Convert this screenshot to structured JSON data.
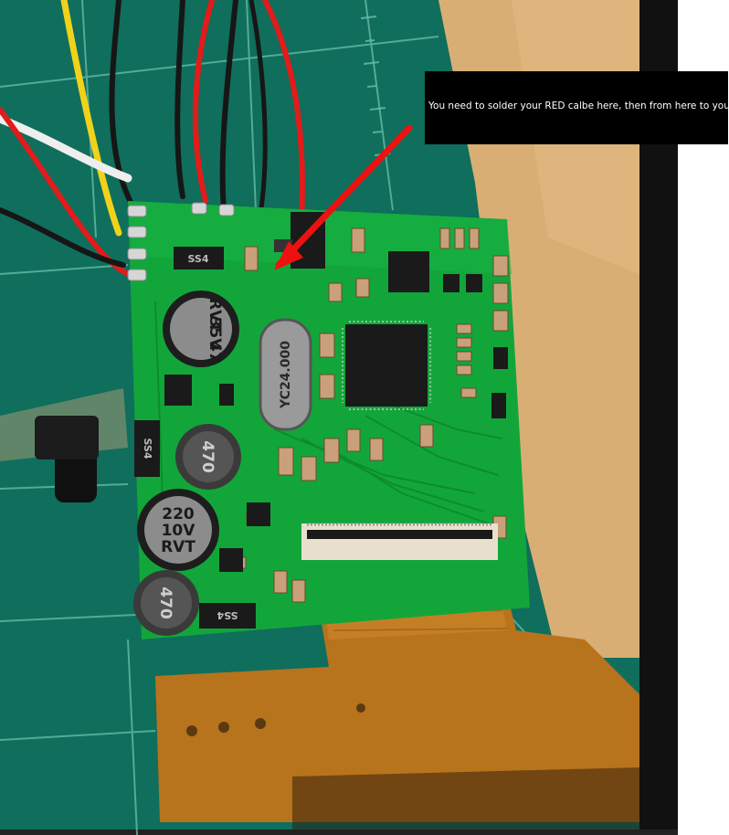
{
  "annotation": {
    "text": "You need to solder your RED calbe here, then from here to your PI",
    "arrow_color": "#ee1111",
    "box_color": "#000000",
    "text_color": "#ffffff"
  },
  "photo": {
    "subject": "green PCB display driver board with attached ribbon cable",
    "colors": {
      "mat": "#0f6e5c",
      "mat_grid": "#6cc0a8",
      "wood": "#d9ae74",
      "pcb": "#12a63a",
      "ribbon": "#b8731d",
      "frame": "#111111"
    }
  },
  "components": {
    "cap_top_left": [
      "47",
      "35V",
      "RVT"
    ],
    "cap_bottom_left": [
      "220",
      "10V",
      "RVT"
    ],
    "crystal": "YC24.000",
    "inductor_mid": "470",
    "inductor_bottom": "470",
    "diode_top": "SS4",
    "diode_bottom": "SS4",
    "diode_side": "SS4"
  }
}
